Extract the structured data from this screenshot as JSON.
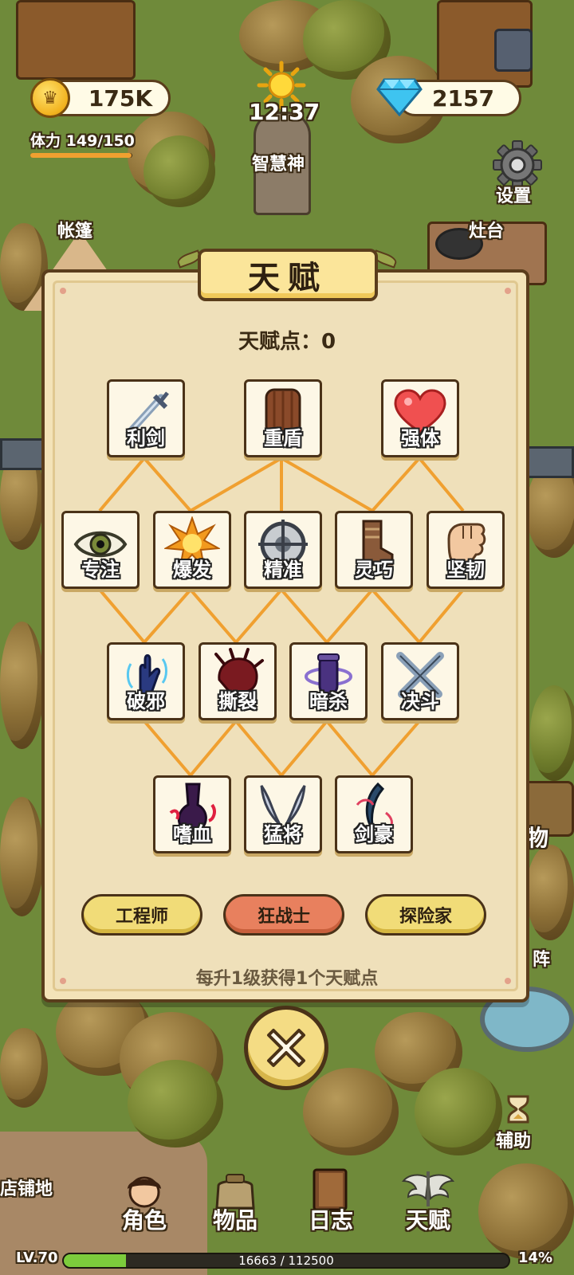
{
  "hud": {
    "gold": "175K",
    "gems": "2157",
    "time": "12:37",
    "stamina_label": "体力",
    "stamina_value": "149/150",
    "stamina_fraction": 0.993
  },
  "map_labels": {
    "statue": "智慧神",
    "tent": "帐篷",
    "stove": "灶台",
    "settings": "设置",
    "side_right": "物",
    "side_right2": "阵",
    "assist": "辅助",
    "store_floor": "店铺地"
  },
  "talent_panel": {
    "title": "天赋",
    "points_label": "天赋点：",
    "points_value": "0",
    "rows": [
      [
        {
          "name": "利剑",
          "icon": "sword-icon"
        },
        {
          "name": "重盾",
          "icon": "shield-icon"
        },
        {
          "name": "强体",
          "icon": "heart-icon"
        }
      ],
      [
        {
          "name": "专注",
          "icon": "eye-icon"
        },
        {
          "name": "爆发",
          "icon": "explosion-icon"
        },
        {
          "name": "精准",
          "icon": "crosshair-icon"
        },
        {
          "name": "灵巧",
          "icon": "boots-icon"
        },
        {
          "name": "坚韧",
          "icon": "fist-icon"
        }
      ],
      [
        {
          "name": "破邪",
          "icon": "spirit-hand-icon"
        },
        {
          "name": "撕裂",
          "icon": "claw-icon"
        },
        {
          "name": "暗杀",
          "icon": "assassin-icon"
        },
        {
          "name": "决斗",
          "icon": "crossed-swords-icon"
        }
      ],
      [
        {
          "name": "嗜血",
          "icon": "blood-icon"
        },
        {
          "name": "猛将",
          "icon": "horns-icon"
        },
        {
          "name": "剑豪",
          "icon": "blade-icon"
        }
      ]
    ],
    "classes": [
      {
        "label": "工程师",
        "active": false
      },
      {
        "label": "狂战士",
        "active": true
      },
      {
        "label": "探险家",
        "active": false
      }
    ],
    "footer": "每升1级获得1个天赋点"
  },
  "bottom_nav": [
    {
      "label": "角色",
      "icon": "character-icon"
    },
    {
      "label": "物品",
      "icon": "bag-icon"
    },
    {
      "label": "日志",
      "icon": "book-icon"
    },
    {
      "label": "天赋",
      "icon": "wings-icon"
    }
  ],
  "level": {
    "label": "LV.70",
    "xp": "16663 / 112500",
    "percent": "14%",
    "fraction": 0.14
  },
  "colors": {
    "panel_bg": "#f3e3b8",
    "border": "#5a3d1c",
    "connector": "#f0a030",
    "active_class": "#e8805e",
    "inactive_class": "#f1dc78"
  }
}
